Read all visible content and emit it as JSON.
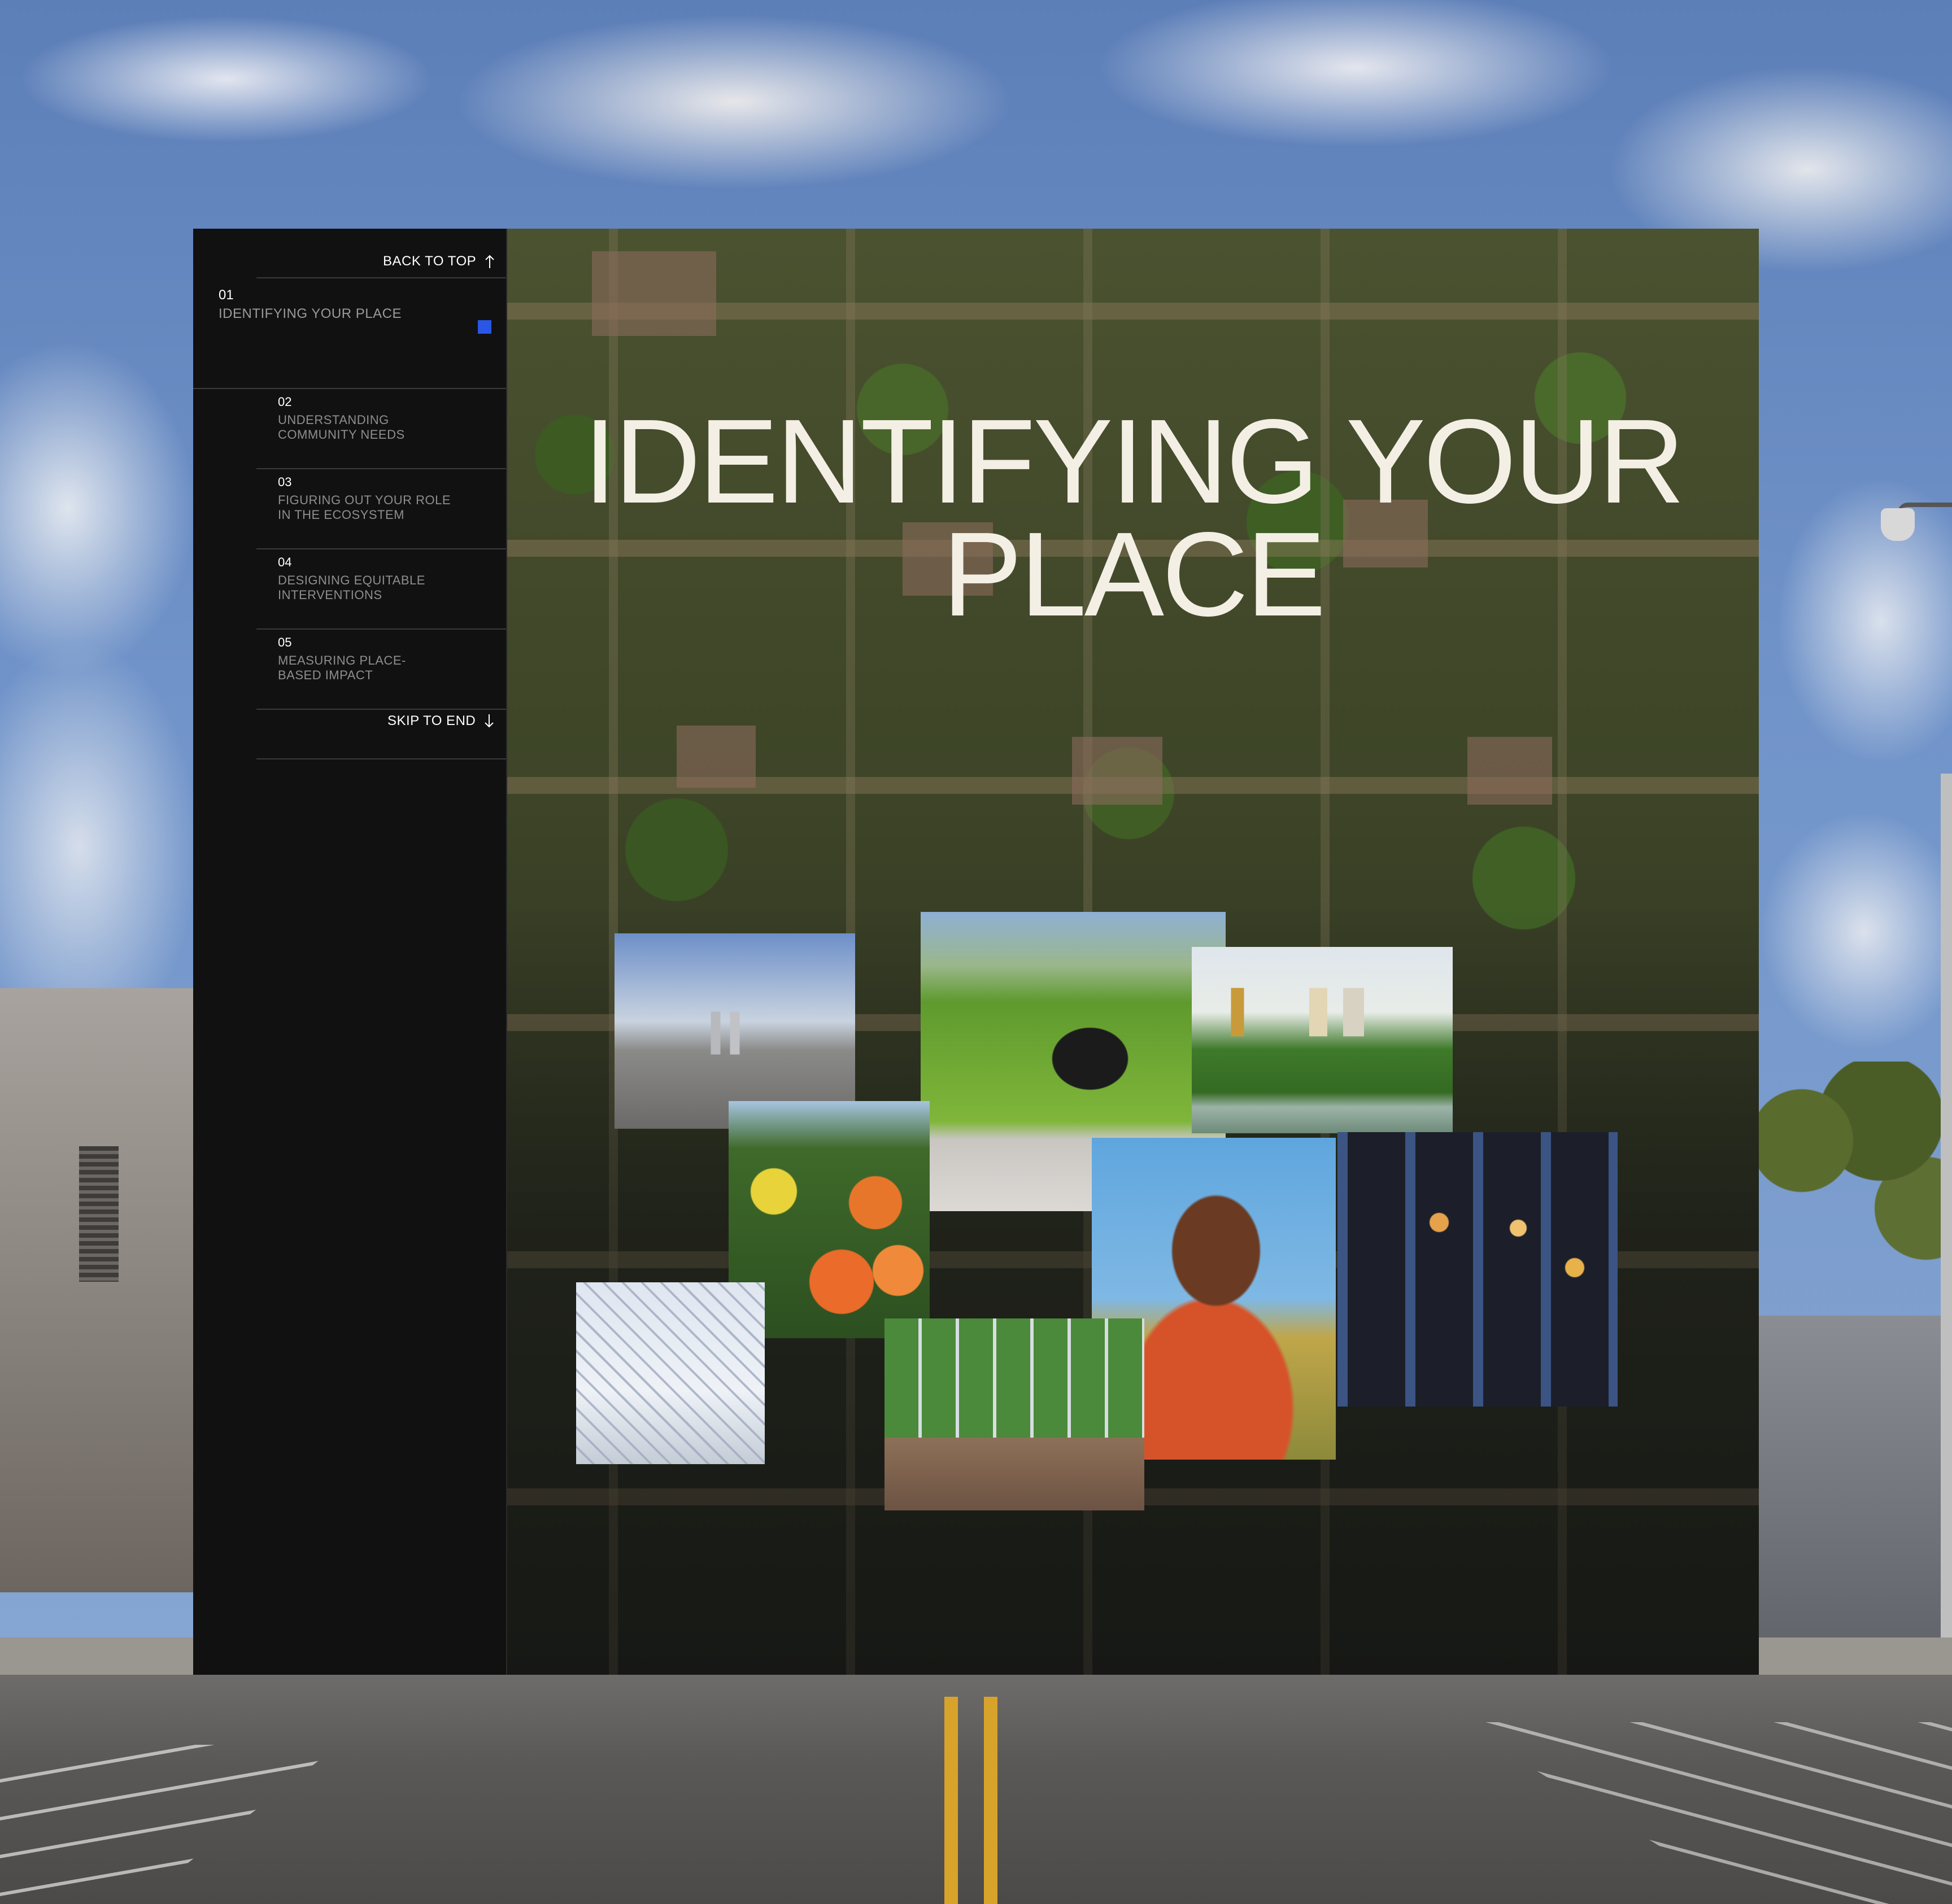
{
  "sidebar": {
    "back_to_top": "BACK TO TOP",
    "skip_to_end": "SKIP TO END",
    "sections": [
      {
        "num": "01",
        "label": "IDENTIFYING YOUR PLACE",
        "active": true
      },
      {
        "num": "02",
        "label": "UNDERSTANDING COMMUNITY NEEDS"
      },
      {
        "num": "03",
        "label": "FIGURING OUT YOUR ROLE IN THE ECOSYSTEM"
      },
      {
        "num": "04",
        "label": "DESIGNING EQUITABLE INTERVENTIONS"
      },
      {
        "num": "05",
        "label": "MEASURING PLACE-BASED IMPACT"
      }
    ]
  },
  "hero": {
    "title_line1": "IDENTIFYING YOUR",
    "title_line2": "PLACE"
  },
  "colors": {
    "accent": "#2a56e6",
    "panel": "#111111",
    "title": "#f4efe4"
  }
}
